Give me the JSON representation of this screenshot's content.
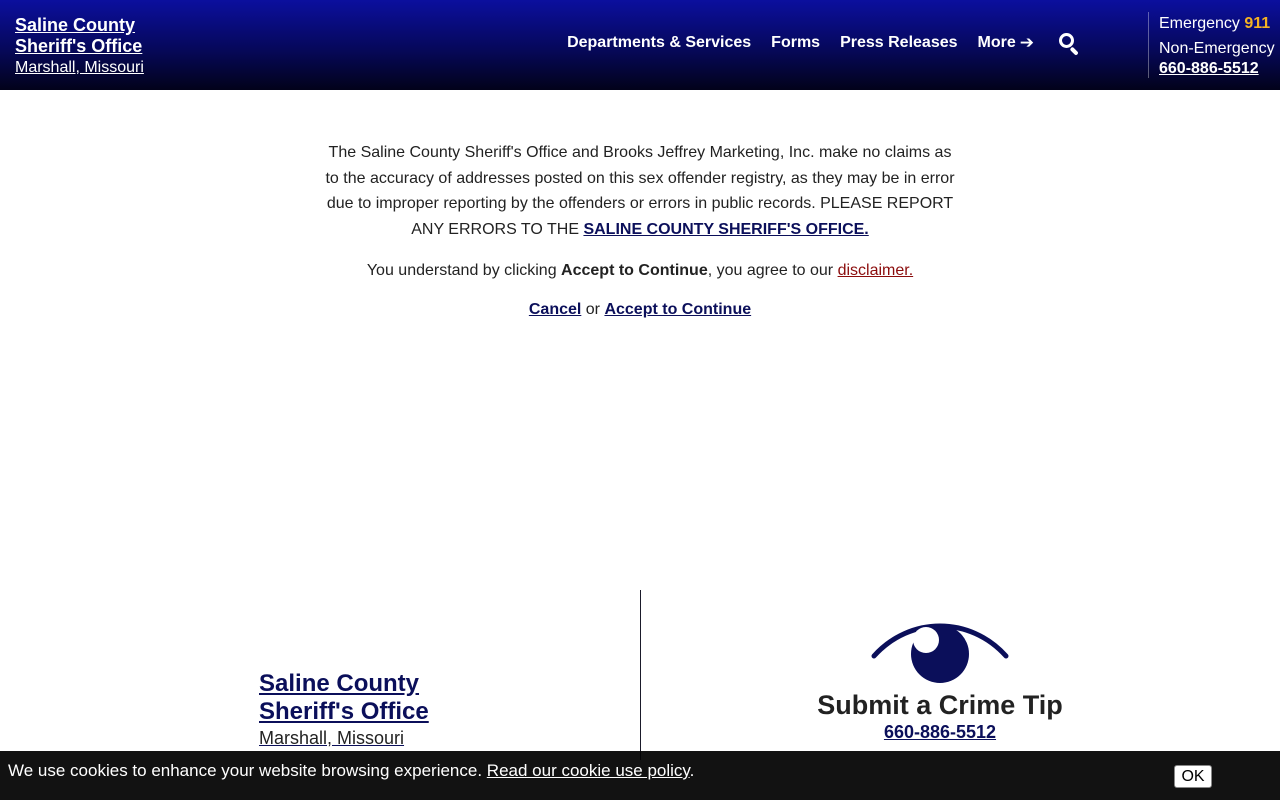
{
  "header": {
    "brand_name_line1": "Saline County",
    "brand_name_line2": "Sheriff's Office",
    "brand_location": "Marshall, Missouri",
    "nav": {
      "departments": "Departments & Services",
      "forms": "Forms",
      "press": "Press Releases",
      "more": "More"
    },
    "emergency_label": "Emergency",
    "emergency_number": "911",
    "non_emergency_label": "Non-Emergency",
    "non_emergency_phone": "660-886-5512"
  },
  "disclaimer": {
    "text": "The Saline County Sheriff's Office and Brooks Jeffrey Marketing, Inc. make no claims as to the accuracy of addresses posted on this sex offender registry, as they may be in error due to improper reporting by the offenders or errors in public records. PLEASE REPORT ANY ERRORS TO THE ",
    "report_link": "SALINE COUNTY SHERIFF'S OFFICE.",
    "agree_prefix": "You understand by clicking ",
    "agree_bold": "Accept to Continue",
    "agree_mid": ", you agree to our ",
    "agree_link": "disclaimer.",
    "cancel": "Cancel",
    "or": " or ",
    "accept": "Accept to Continue"
  },
  "footer": {
    "brand_name_line1": "Saline County",
    "brand_name_line2": "Sheriff's Office",
    "brand_location": "Marshall, Missouri",
    "tip_title": "Submit a Crime Tip",
    "tip_phone": "660-886-5512"
  },
  "cookie": {
    "message": "We use cookies to enhance your website browsing experience. ",
    "policy_link": "Read our cookie use policy",
    "trailing": ".",
    "ok": "OK"
  },
  "colors": {
    "header_top": "#0b0f9e",
    "header_bottom": "#02021a",
    "accent_gold": "#f4b223",
    "link_navy": "#0b0f5a",
    "link_red": "#8b0c0c"
  }
}
